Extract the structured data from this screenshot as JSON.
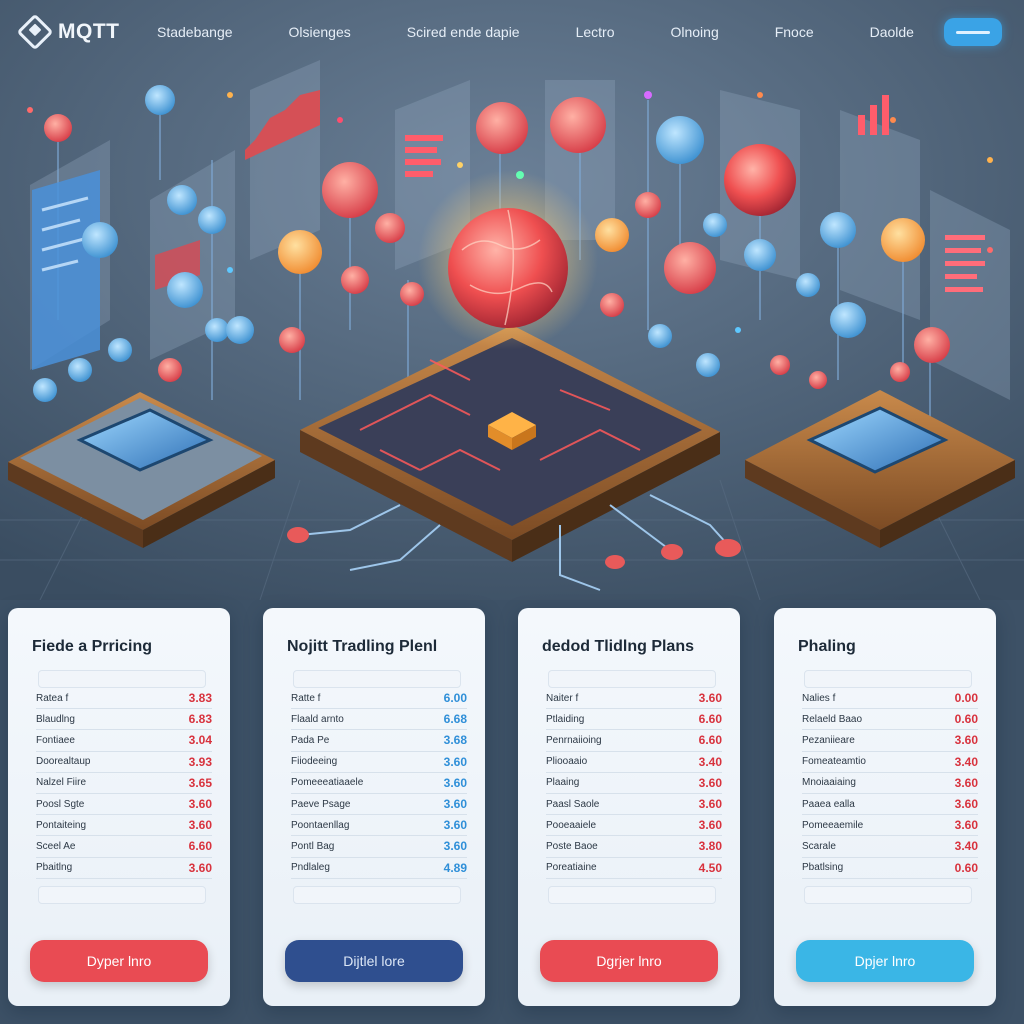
{
  "header": {
    "logo_text": "MQTT",
    "nav": [
      "Stadebange",
      "Olsienges",
      "Scired ende dapie",
      "Lectro",
      "Olnoing",
      "Fnoce",
      "Daolde"
    ]
  },
  "colors": {
    "accent_red": "#e94b53",
    "accent_blue": "#3aa3e6",
    "navy": "#2f4f8f",
    "background": "#3d5166"
  },
  "pricing_cards": [
    {
      "title": "Fiede a Prricing",
      "value_color": "#d8323d",
      "button_label": "Dyper lnro",
      "button_color": "#e94b53",
      "button_text_color": "#ffffff",
      "rows": [
        {
          "label": "Ratea f",
          "value": "3.83"
        },
        {
          "label": "Blaudlng",
          "value": "6.83"
        },
        {
          "label": "Fontiaee",
          "value": "3.04"
        },
        {
          "label": "Doorealtaup",
          "value": "3.93"
        },
        {
          "label": "Nalzel Fiire",
          "value": "3.65"
        },
        {
          "label": "Poosl Sgte",
          "value": "3.60"
        },
        {
          "label": "Pontaiteing",
          "value": "3.60"
        },
        {
          "label": "Sceel Ae",
          "value": "6.60"
        },
        {
          "label": "Pbaitlng",
          "value": "3.60"
        }
      ]
    },
    {
      "title": "Nojitt Tradling Plenl",
      "value_color": "#2f8fd8",
      "button_label": "Dijtlel lore",
      "button_color": "#2f4f8f",
      "button_text_color": "#dbe6f5",
      "rows": [
        {
          "label": "Ratte f",
          "value": "6.00"
        },
        {
          "label": "Flaald arnto",
          "value": "6.68"
        },
        {
          "label": "Pada Pe",
          "value": "3.68"
        },
        {
          "label": "Fiiodeeing",
          "value": "3.60"
        },
        {
          "label": "Pomeeeatiaaele",
          "value": "3.60"
        },
        {
          "label": "Paeve Psage",
          "value": "3.60"
        },
        {
          "label": "Poontaenllag",
          "value": "3.60"
        },
        {
          "label": "Pontl Bag",
          "value": "3.60"
        },
        {
          "label": "Pndlaleg",
          "value": "4.89"
        }
      ]
    },
    {
      "title": "dedod Tlidlng Plans",
      "value_color": "#d8323d",
      "button_label": "Dgrjer lnro",
      "button_color": "#e94b53",
      "button_text_color": "#ffffff",
      "rows": [
        {
          "label": "Naiter f",
          "value": "3.60"
        },
        {
          "label": "Ptlaiding",
          "value": "6.60"
        },
        {
          "label": "Penrnaiioing",
          "value": "6.60"
        },
        {
          "label": "Pliooaaio",
          "value": "3.40"
        },
        {
          "label": "Plaaing",
          "value": "3.60"
        },
        {
          "label": "Paasl Saole",
          "value": "3.60"
        },
        {
          "label": "Pooeaaiele",
          "value": "3.60"
        },
        {
          "label": "Poste Baoe",
          "value": "3.80"
        },
        {
          "label": "Poreatiaine",
          "value": "4.50"
        }
      ]
    },
    {
      "title": "Phaling",
      "value_color": "#d8323d",
      "button_label": "Dpjer lnro",
      "button_color": "#3ab6e6",
      "button_text_color": "#ffffff",
      "rows": [
        {
          "label": "Nalies f",
          "value": "0.00"
        },
        {
          "label": "Relaeld Baao",
          "value": "0.60"
        },
        {
          "label": "Pezaniieare",
          "value": "3.60"
        },
        {
          "label": "Fomeateamtio",
          "value": "3.40"
        },
        {
          "label": "Mnoiaaiaing",
          "value": "3.60"
        },
        {
          "label": "Paaea ealla",
          "value": "3.60"
        },
        {
          "label": "Pomeeaemile",
          "value": "3.60"
        },
        {
          "label": "Scarale",
          "value": "3.40"
        },
        {
          "label": "Pbatlsing",
          "value": "0.60"
        }
      ]
    }
  ]
}
